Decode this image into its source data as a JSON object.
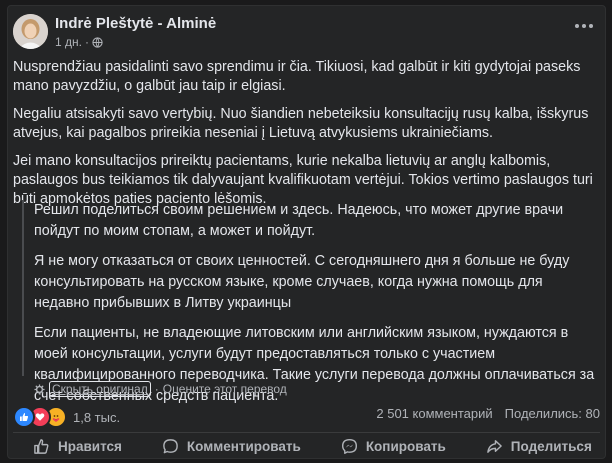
{
  "post": {
    "author": "Indrė Pleštytė - Alminė",
    "time": "1 дн.",
    "audience_icon": "globe-icon",
    "paragraphs": [
      "Nusprendžiau pasidalinti savo sprendimu ir čia. Tikiuosi, kad galbūt ir kiti gydytojai paseks mano pavyzdžiu, o galbūt jau taip ir elgiasi.",
      "Negaliu atsisakyti savo vertybių. Nuo šiandien nebeteiksiu konsultacijų rusų kalba, išskyrus atvejus, kai pagalbos prireikia neseniai į Lietuvą atvykusiems ukrainiečiams.",
      "Jei mano konsultacijos prireiktų pacientams, kurie nekalba lietuvių ar anglų kalbomis, paslaugos bus teikiamos tik dalyvaujant kvalifikuotam vertėjui. Tokios vertimo paslaugos turi būti apmokėtos paties paciento lėšomis."
    ],
    "translation": [
      "Решил поделиться своим решением и здесь. Надеюсь, что может другие врачи пойдут по моим стопам, а может и пойдут.",
      "Я не могу отказаться от своих ценностей. С сегодняшнего дня я больше не буду консультировать на русском языке, кроме случаев, когда нужна помощь для недавно прибывших в Литву украинцы",
      "Если пациенты, не владеющие литовским или английским языком, нуждаются в моей консультации, услуги будут предоставляться только с участием квалифицированного переводчика. Такие услуги перевода должны оплачиваться за счет собственных средств пациента."
    ],
    "translation_links": {
      "hide_original": "Скрыть оригинал",
      "separator": "·",
      "rate": "Оцените этот перевод"
    }
  },
  "stats": {
    "reactions_count": "1,8 тыс.",
    "comments": "2 501 комментарий",
    "shares": "Поделились: 80"
  },
  "actions": {
    "like": "Нравится",
    "comment": "Комментировать",
    "copy": "Копировать",
    "share": "Поделиться"
  },
  "colors": {
    "background": "#242526",
    "text": "#e4e6eb",
    "secondary": "#b0b3b8",
    "like_blue": "#2d88ff",
    "love_red": "#f33e58",
    "care_yellow": "#f7b125"
  }
}
